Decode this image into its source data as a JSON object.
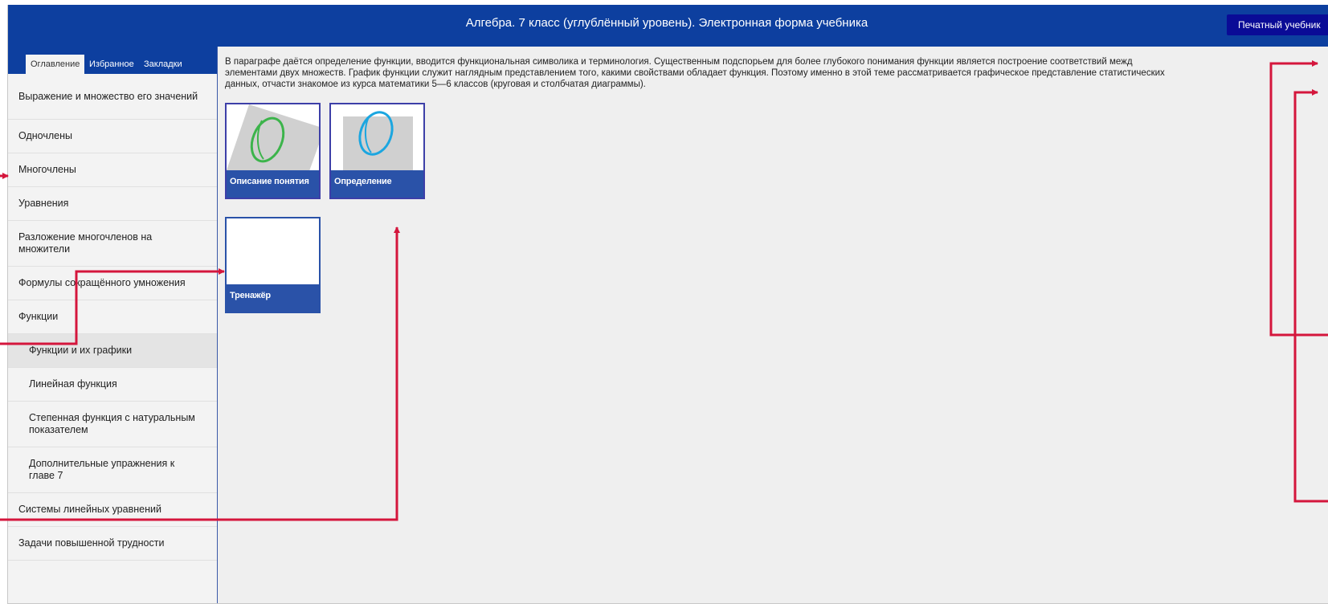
{
  "header": {
    "title": "Алгебра. 7 класс (углублённый уровень). Электронная форма учебника",
    "print_button": "Печатный учебник"
  },
  "sidebar": {
    "tabs": [
      "Оглавление",
      "Избранное",
      "Закладки"
    ],
    "items": [
      {
        "label": "Выражение и множество его значений"
      },
      {
        "label": "Одночлены"
      },
      {
        "label": "Многочлены"
      },
      {
        "label": "Уравнения"
      },
      {
        "label": "Разложение многочленов на множители"
      },
      {
        "label": "Формулы сокращённого умножения"
      },
      {
        "label": "Функции"
      },
      {
        "label": "Функции и их графики"
      },
      {
        "label": "Линейная функция"
      },
      {
        "label": "Степенная функция с натуральным показателем"
      },
      {
        "label": "Дополнительные упражнения к главе 7"
      },
      {
        "label": "Системы линейных уравнений"
      },
      {
        "label": "Задачи повышенной трудности"
      }
    ]
  },
  "main": {
    "intro": [
      "В параграфе даётся определение функции, вводится функциональная символика и терминология. Существенным подспорьем для более глубокого понимания функции является построение соответствий межд",
      "элементами двух множеств. График функции служит наглядным представлением того, какими свойствами обладает функция. Поэтому именно в этой теме рассматривается графическое представление статистических",
      "данных, отчасти знакомое из курса математики 5—6 классов (круговая и столбчатая диаграммы)."
    ],
    "cards": [
      {
        "label": "Описание понятия",
        "icon": "concept-thumbnail"
      },
      {
        "label": "Определение",
        "icon": "definition-thumbnail"
      },
      {
        "label": "Тренажёр",
        "icon": "trainer-thumbnail"
      }
    ]
  },
  "right_toolbar": {
    "icons": [
      "info-icon",
      "star-icon"
    ]
  },
  "colors": {
    "header": "#0d3f9f",
    "card": "#2a52a8",
    "annotation_arrow": "#d4163c",
    "green_symbol": "#3cb44b",
    "blue_symbol": "#1ba6e0"
  }
}
